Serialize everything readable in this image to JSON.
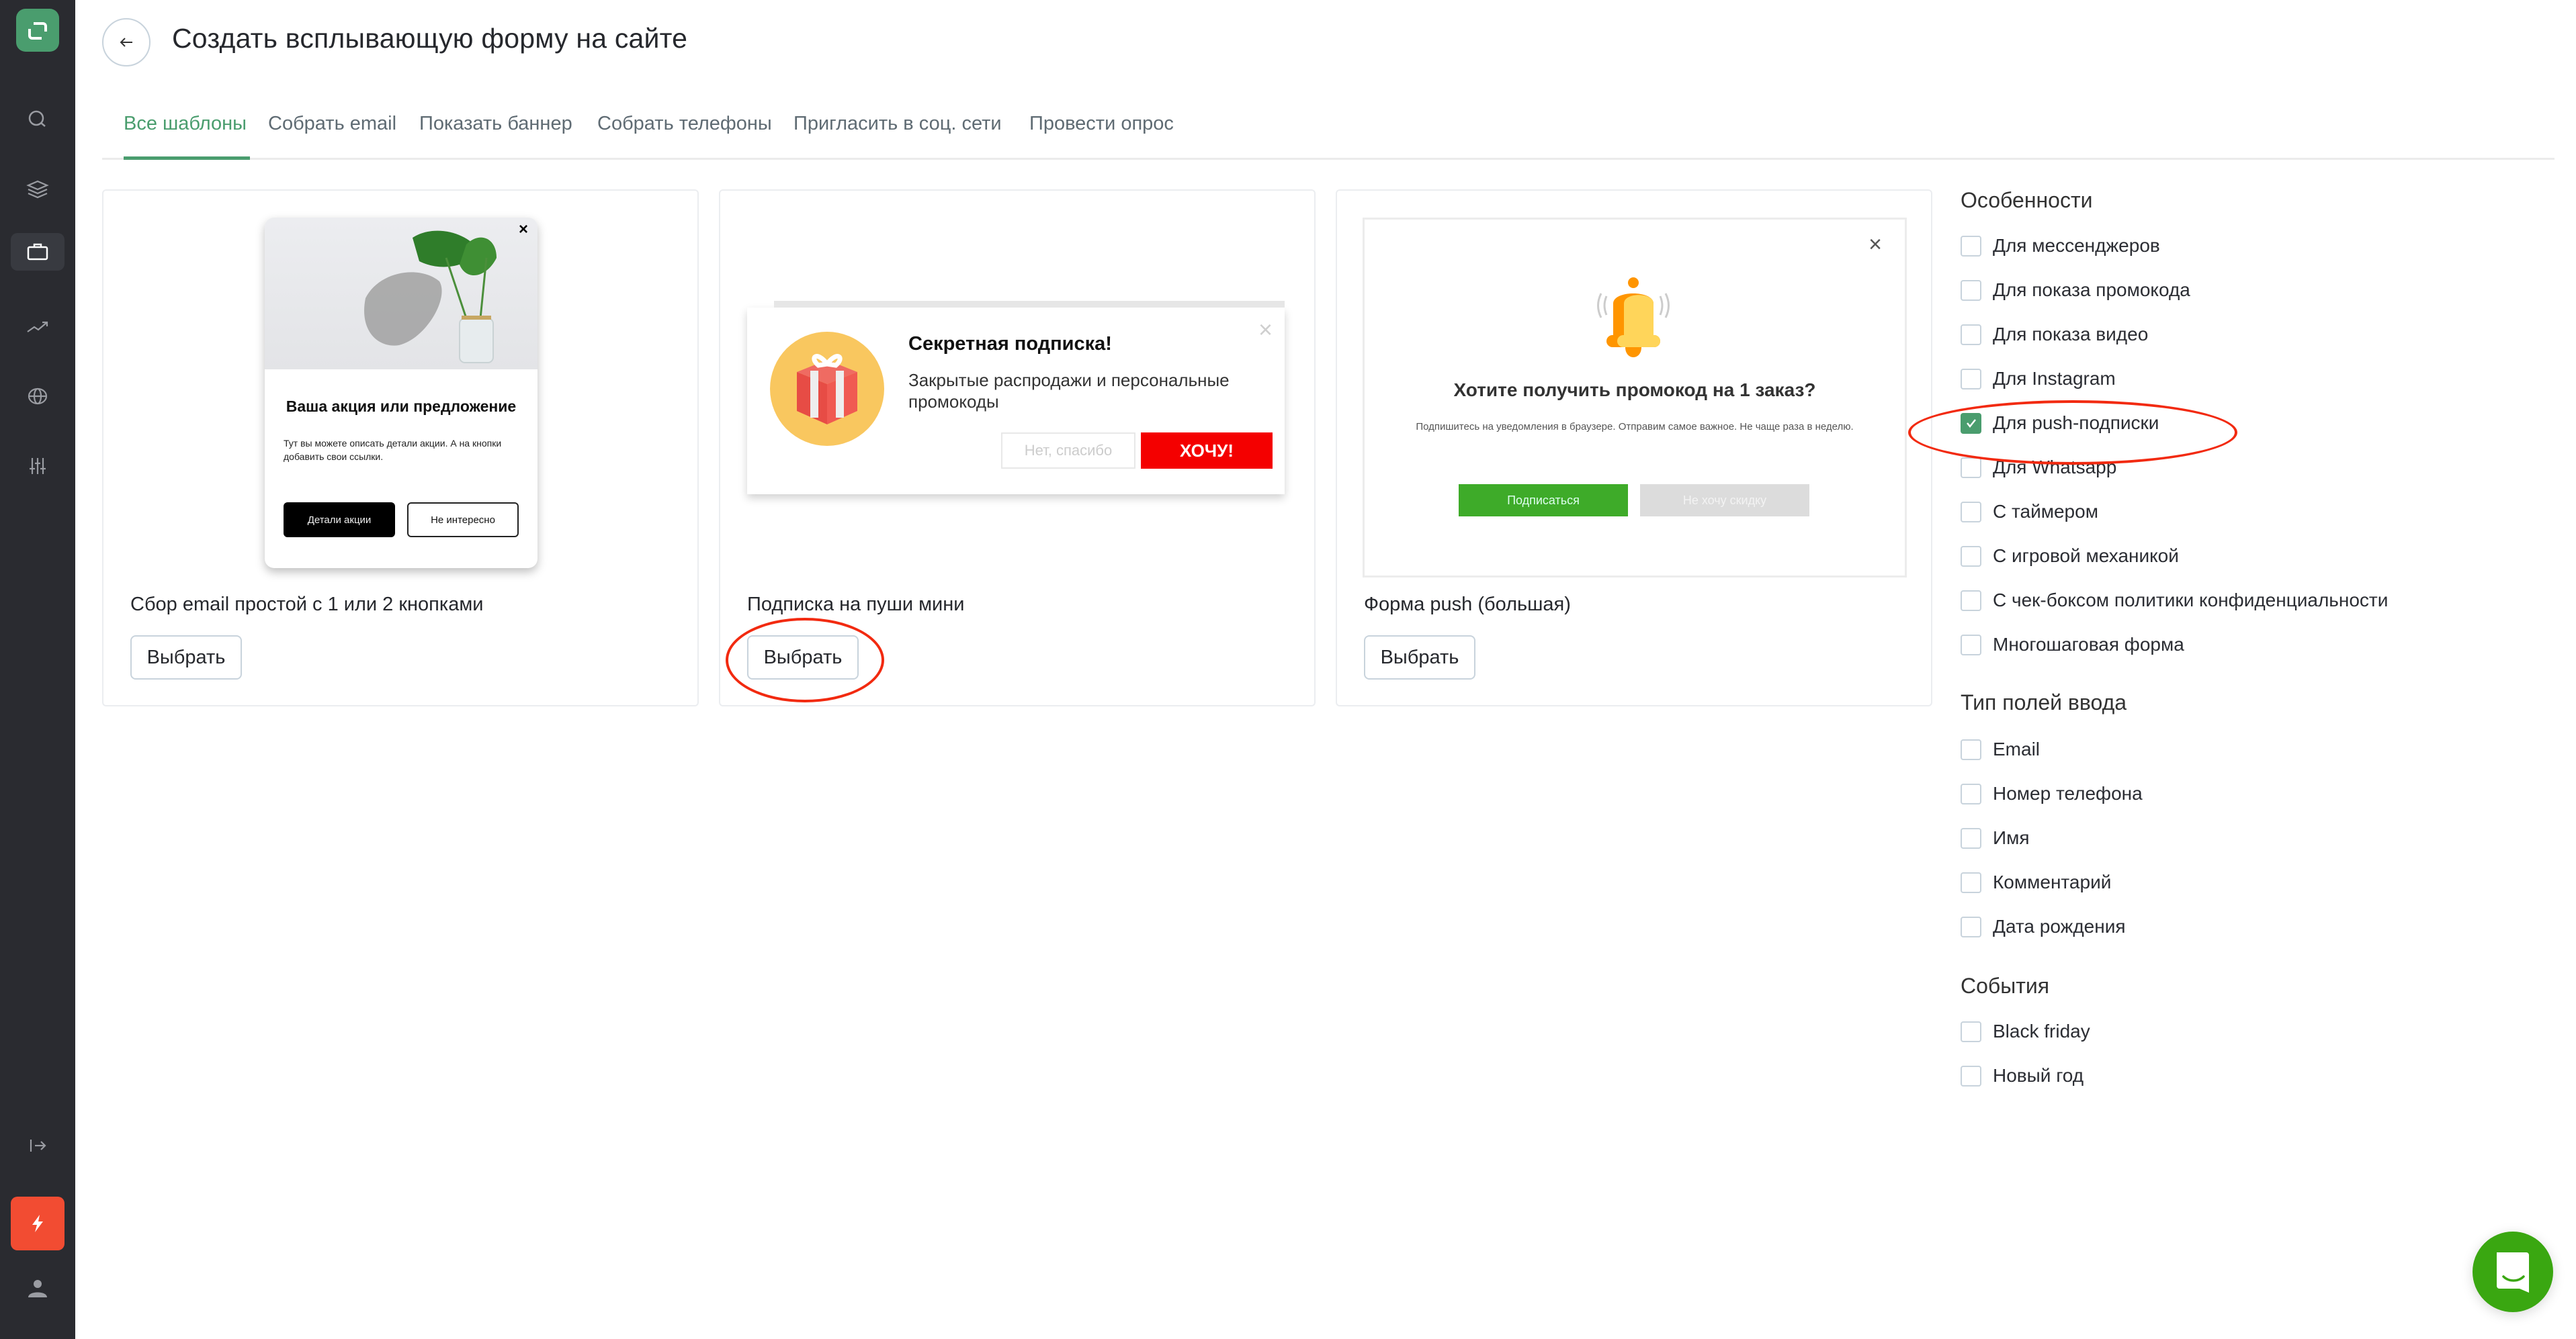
{
  "sidebar": {
    "items": [
      {
        "icon": "search-icon"
      },
      {
        "icon": "layers-icon"
      },
      {
        "icon": "briefcase-icon",
        "active": true
      },
      {
        "icon": "trending-up-icon"
      },
      {
        "icon": "globe-icon"
      },
      {
        "icon": "sliders-icon"
      },
      {
        "icon": "logout-icon"
      },
      {
        "icon": "bolt-icon"
      },
      {
        "icon": "user-icon"
      }
    ]
  },
  "header": {
    "title": "Создать всплывающую форму на сайте"
  },
  "tabs": [
    {
      "label": "Все шаблоны",
      "active": true
    },
    {
      "label": "Собрать email"
    },
    {
      "label": "Показать баннер"
    },
    {
      "label": "Собрать телефоны"
    },
    {
      "label": "Пригласить в соц. сети"
    },
    {
      "label": "Провести опрос"
    }
  ],
  "templates": [
    {
      "title": "Сбор email простой с 1 или 2 кнопками",
      "button": "Выбрать",
      "preview": {
        "heading": "Ваша акция или предложение",
        "text": "Тут вы можете описать детали акции. А на кнопки добавить свои ссылки.",
        "primary": "Детали акции",
        "secondary": "Не интересно",
        "close": "×"
      }
    },
    {
      "title": "Подписка на пуши мини",
      "button": "Выбрать",
      "preview": {
        "heading": "Секретная подписка!",
        "text": "Закрытые распродажи и персональные промокоды",
        "secondary": "Нет, спасибо",
        "primary": "ХОЧУ!",
        "close": "×"
      }
    },
    {
      "title": "Форма push (большая)",
      "button": "Выбрать",
      "preview": {
        "heading": "Хотите получить промокод на 1 заказ?",
        "text": "Подпишитесь на уведомления в браузере. Отправим самое важное. Не чаще раза в неделю.",
        "primary": "Подписаться",
        "secondary": "Не хочу скидку",
        "close": "×"
      }
    }
  ],
  "filters": {
    "groups": [
      {
        "title": "Особенности",
        "items": [
          {
            "label": "Для мессенджеров",
            "checked": false
          },
          {
            "label": "Для показа промокода",
            "checked": false
          },
          {
            "label": "Для показа видео",
            "checked": false
          },
          {
            "label": "Для Instagram",
            "checked": false
          },
          {
            "label": "Для push-подписки",
            "checked": true
          },
          {
            "label": "Для Whatsapp",
            "checked": false
          },
          {
            "label": "С таймером",
            "checked": false
          },
          {
            "label": "С игровой механикой",
            "checked": false
          },
          {
            "label": "С чек-боксом политики конфиденциальности",
            "checked": false
          },
          {
            "label": "Многошаговая форма",
            "checked": false
          }
        ]
      },
      {
        "title": "Тип полей ввода",
        "items": [
          {
            "label": "Email",
            "checked": false
          },
          {
            "label": "Номер телефона",
            "checked": false
          },
          {
            "label": "Имя",
            "checked": false
          },
          {
            "label": "Комментарий",
            "checked": false
          },
          {
            "label": "Дата рождения",
            "checked": false
          }
        ]
      },
      {
        "title": "События",
        "items": [
          {
            "label": "Black friday",
            "checked": false
          },
          {
            "label": "Новый год",
            "checked": false
          }
        ]
      }
    ]
  },
  "colors": {
    "accent": "#4a9d6e",
    "sidebar_bg": "#2a2b30",
    "bolt": "#f24c32",
    "chat": "#3aa711",
    "annotation": "#f22a10"
  }
}
